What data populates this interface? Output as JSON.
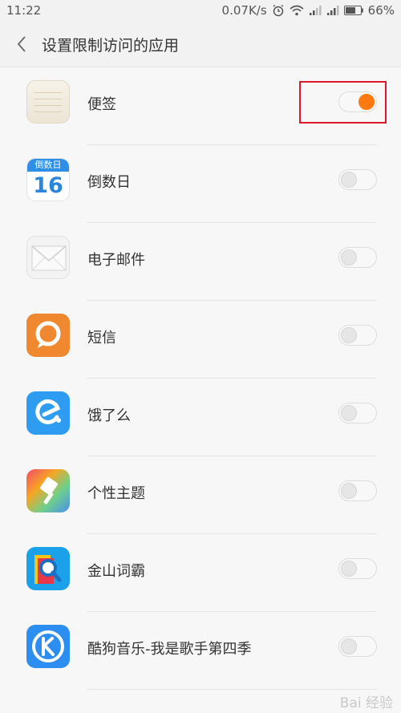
{
  "status_bar": {
    "time": "11:22",
    "speed": "0.07K/s",
    "battery": "66%",
    "icons": [
      "alarm-icon",
      "wifi-icon",
      "signal-icon",
      "signal-icon",
      "battery-icon"
    ]
  },
  "header": {
    "title": "设置限制访问的应用"
  },
  "apps": [
    {
      "name": "便签",
      "icon": "notes-icon",
      "enabled": true
    },
    {
      "name": "倒数日",
      "icon": "calendar-icon",
      "enabled": false,
      "icon_top": "倒数日",
      "icon_num": "16"
    },
    {
      "name": "电子邮件",
      "icon": "mail-icon",
      "enabled": false
    },
    {
      "name": "短信",
      "icon": "sms-icon",
      "enabled": false
    },
    {
      "name": "饿了么",
      "icon": "eleme-icon",
      "enabled": false
    },
    {
      "name": "个性主题",
      "icon": "theme-icon",
      "enabled": false
    },
    {
      "name": "金山词霸",
      "icon": "dictionary-icon",
      "enabled": false
    },
    {
      "name": "酷狗音乐-我是歌手第四季",
      "icon": "kugou-icon",
      "enabled": false
    }
  ],
  "colors": {
    "accent": "#ff7a0e",
    "highlight": "#e0182c"
  },
  "watermark": "Bai 经验"
}
